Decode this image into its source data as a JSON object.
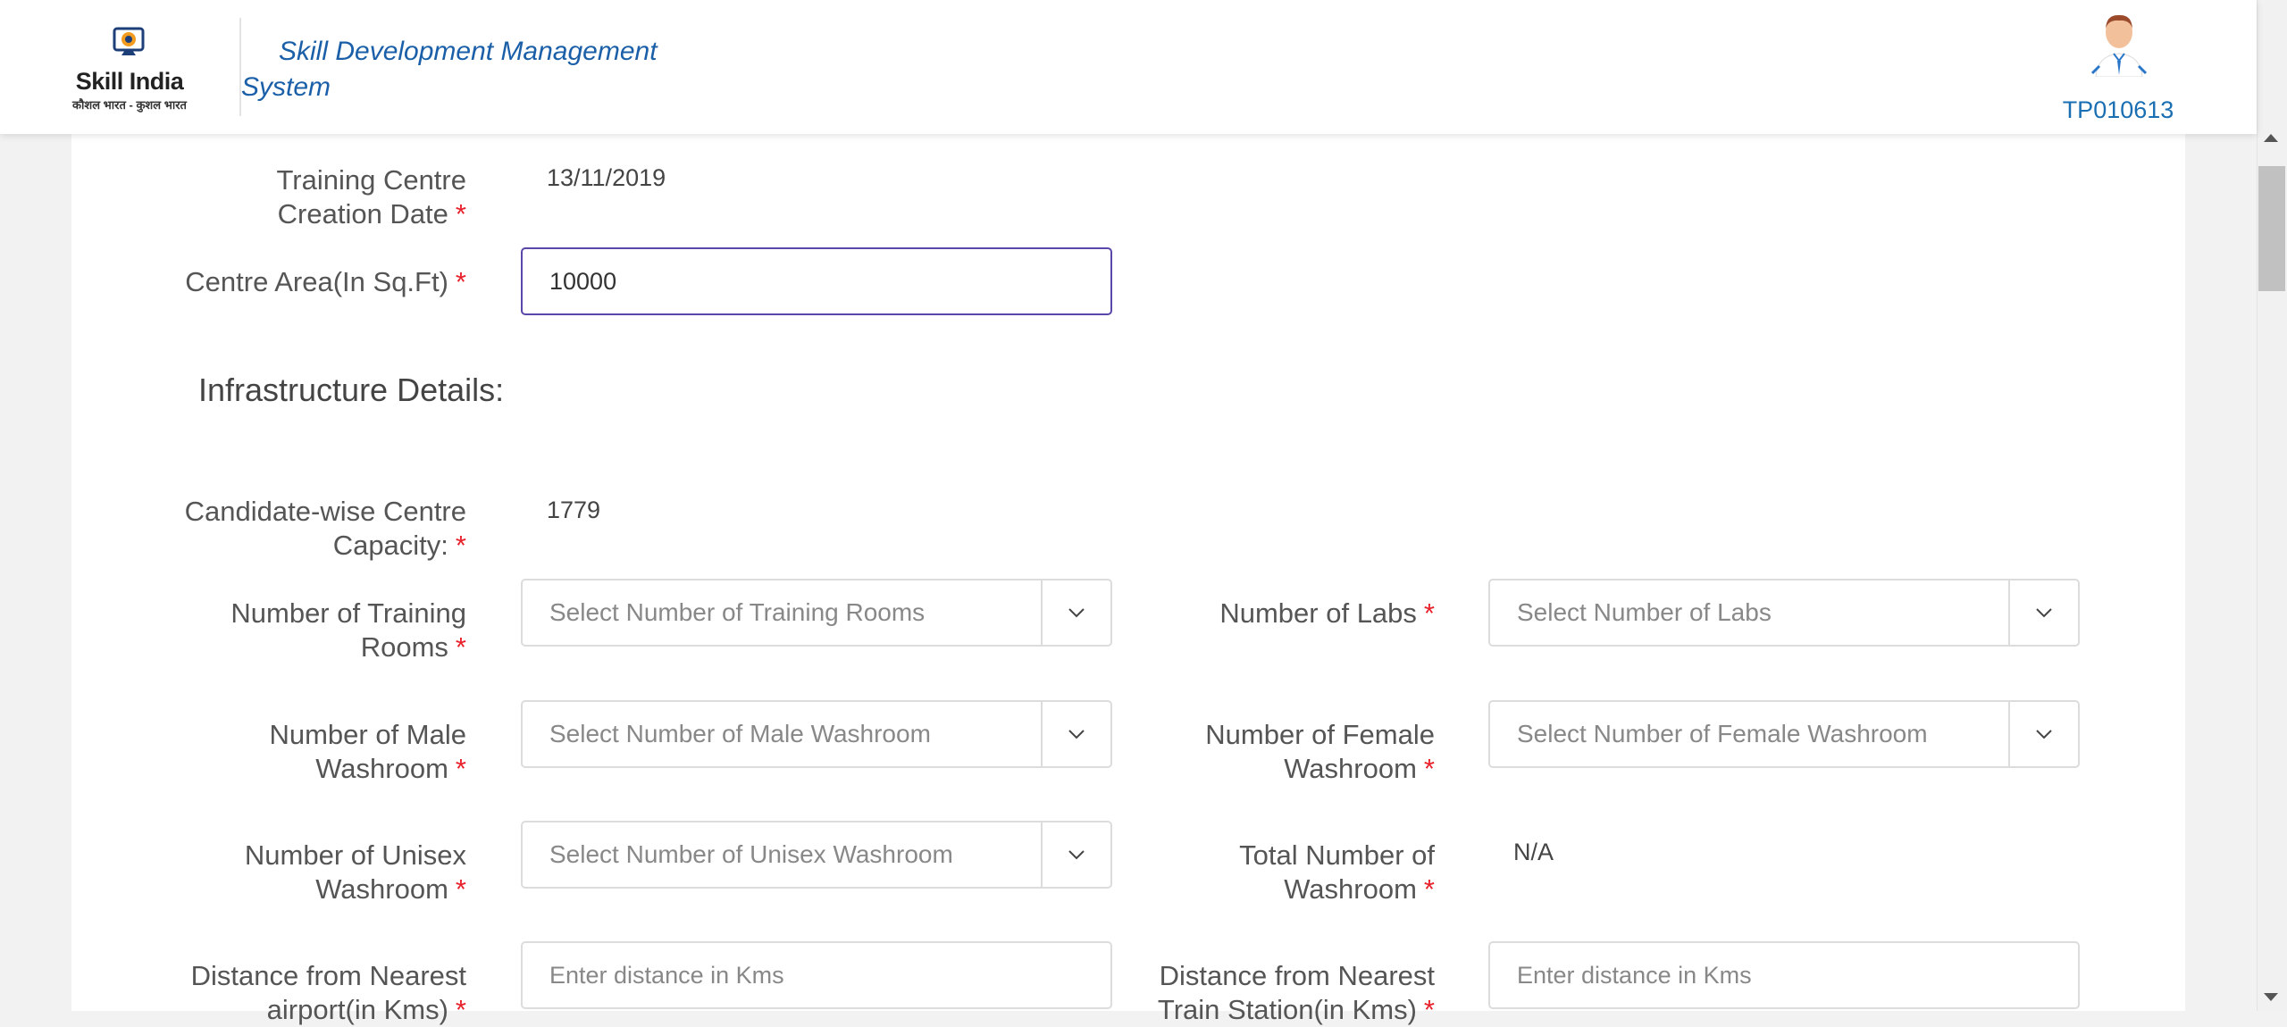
{
  "header": {
    "brand": "Skill India",
    "tagline": "कौशल भारत - कुशल भारत",
    "app_title_line1": "Skill Development Management",
    "app_title_line2": "System",
    "user_id": "TP010613"
  },
  "form": {
    "creation_date": {
      "label_l1": "Training Centre",
      "label_l2": "Creation Date",
      "value": "13/11/2019"
    },
    "centre_area": {
      "label": "Centre Area(In Sq.Ft)",
      "value": "10000"
    },
    "infrastructure_heading": "Infrastructure Details:",
    "capacity": {
      "label_l1": "Candidate-wise Centre",
      "label_l2": "Capacity:",
      "value": "1779"
    },
    "training_rooms": {
      "label_l1": "Number of Training",
      "label_l2": "Rooms",
      "placeholder": "Select Number of Training Rooms"
    },
    "labs": {
      "label": "Number of Labs",
      "placeholder": "Select Number of Labs"
    },
    "male_washroom": {
      "label_l1": "Number of Male",
      "label_l2": "Washroom",
      "placeholder": "Select Number of Male Washroom"
    },
    "female_washroom": {
      "label_l1": "Number of Female",
      "label_l2": "Washroom",
      "placeholder": "Select Number of Female Washroom"
    },
    "unisex_washroom": {
      "label_l1": "Number of Unisex",
      "label_l2": "Washroom",
      "placeholder": "Select Number of Unisex Washroom"
    },
    "total_washroom": {
      "label_l1": "Total Number of",
      "label_l2": "Washroom",
      "value": "N/A"
    },
    "airport_distance": {
      "label_l1": "Distance from Nearest",
      "label_l2": "airport(in Kms)",
      "placeholder": "Enter distance in Kms"
    },
    "train_distance": {
      "label_l1": "Distance from Nearest",
      "label_l2": "Train Station(in Kms)",
      "placeholder": "Enter distance in Kms"
    },
    "required_mark": "*"
  },
  "colors": {
    "required": "#e8212b",
    "link_blue": "#1a6fb3",
    "active_border": "#5b47a9"
  }
}
